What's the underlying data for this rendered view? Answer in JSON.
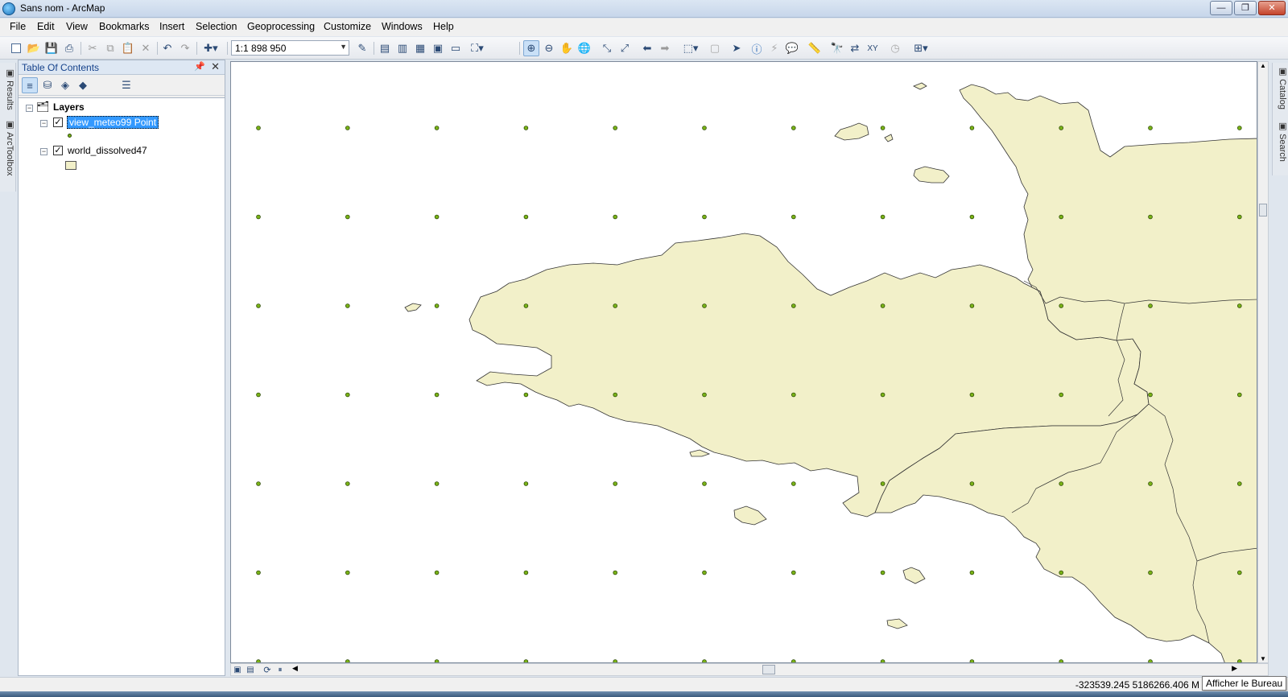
{
  "window": {
    "title": "Sans nom - ArcMap"
  },
  "menu": [
    "File",
    "Edit",
    "View",
    "Bookmarks",
    "Insert",
    "Selection",
    "Geoprocessing",
    "Customize",
    "Windows",
    "Help"
  ],
  "toolbar": {
    "scale": "1:1 898 950"
  },
  "left_dock": {
    "tabs": [
      "Results",
      "ArcToolbox"
    ]
  },
  "right_dock": {
    "tabs": [
      "Catalog",
      "Search"
    ]
  },
  "toc": {
    "title": "Table Of Contents",
    "root": "Layers",
    "layers": [
      {
        "name": "view_meteo99 Point",
        "checked": true,
        "selected": true
      },
      {
        "name": "world_dissolved47",
        "checked": true,
        "selected": false
      }
    ]
  },
  "map": {
    "land_color": "#f2f0c9",
    "point_color": "#7ab317",
    "outline_color": "#333333"
  },
  "status": {
    "coords": "-323539.245  5186266.406 M"
  },
  "tooltip": {
    "text": "Afficher le Bureau"
  }
}
